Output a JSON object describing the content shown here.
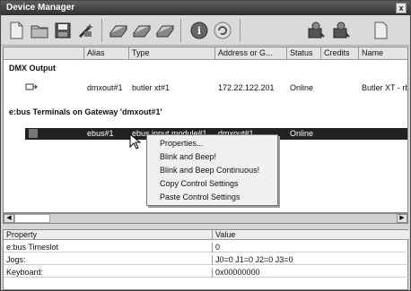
{
  "window": {
    "title": "Device Manager",
    "close_glyph": "x"
  },
  "toolbar": {
    "icons": [
      "page-icon",
      "folder-icon",
      "save-icon",
      "wizard-icon",
      "device-icon",
      "device-icon",
      "device-icon",
      "info-icon",
      "refresh-icon",
      "device-user-icon",
      "device-user-icon",
      "page-icon"
    ]
  },
  "grid": {
    "columns": [
      "Alias",
      "Type",
      "Address or G...",
      "Status",
      "Credits",
      "Name"
    ],
    "section_dmx": "DMX Output",
    "dmx_row": {
      "alias": "dmxout#1",
      "type": "butler xt#1",
      "address": "172.22.122.201",
      "status": "Online",
      "name": "Butler XT - rb"
    },
    "section_ebus": "e:bus Terminals on Gateway 'dmxout#1'",
    "ebus_row": {
      "alias": "ebus#1",
      "type": "ebus input module#1",
      "address": "dmxout#1",
      "status": "Online"
    }
  },
  "context_menu": {
    "items": [
      "Properties...",
      "Blink and Beep!",
      "Blink and Beep Continuous!",
      "Copy Control Settings",
      "Paste Control Settings"
    ]
  },
  "properties": {
    "header": {
      "name": "Property",
      "value": "Value"
    },
    "rows": [
      {
        "name": "e:bus Timeslot",
        "value": "0"
      },
      {
        "name": "Jogs:",
        "value": "J0=0  J1=0  J2=0  J3=0"
      },
      {
        "name": "Keyboard:",
        "value": "0x00000000"
      }
    ]
  },
  "scrollbar": {
    "left_arrow": "◀",
    "right_arrow": "▶"
  },
  "colors": {
    "titlebar": "#3a3a3a",
    "selection": "#222222"
  }
}
